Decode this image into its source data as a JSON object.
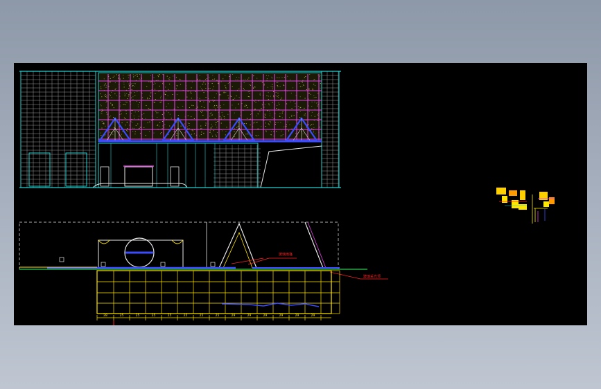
{
  "drawing": {
    "background_color": "#000000",
    "page_background_top": "#8d98a8",
    "page_background_bottom": "#bfc6d2",
    "line_colors": {
      "outline": "#26d0d0",
      "grid": "#c8c8c8",
      "facade_glass": "#e040e0",
      "structure": "#3a4cff",
      "dimension": "#ffe600",
      "annotation": "#ff2020",
      "ground": "#30ff60"
    }
  },
  "section": {
    "annotations": [
      "玻璃雨篷",
      "玻璃采光顶"
    ],
    "dimension_labels": [
      "28",
      "25",
      "25",
      "25",
      "25",
      "25",
      "25",
      "25",
      "29",
      "29",
      "29",
      "29",
      "29",
      "29"
    ]
  }
}
